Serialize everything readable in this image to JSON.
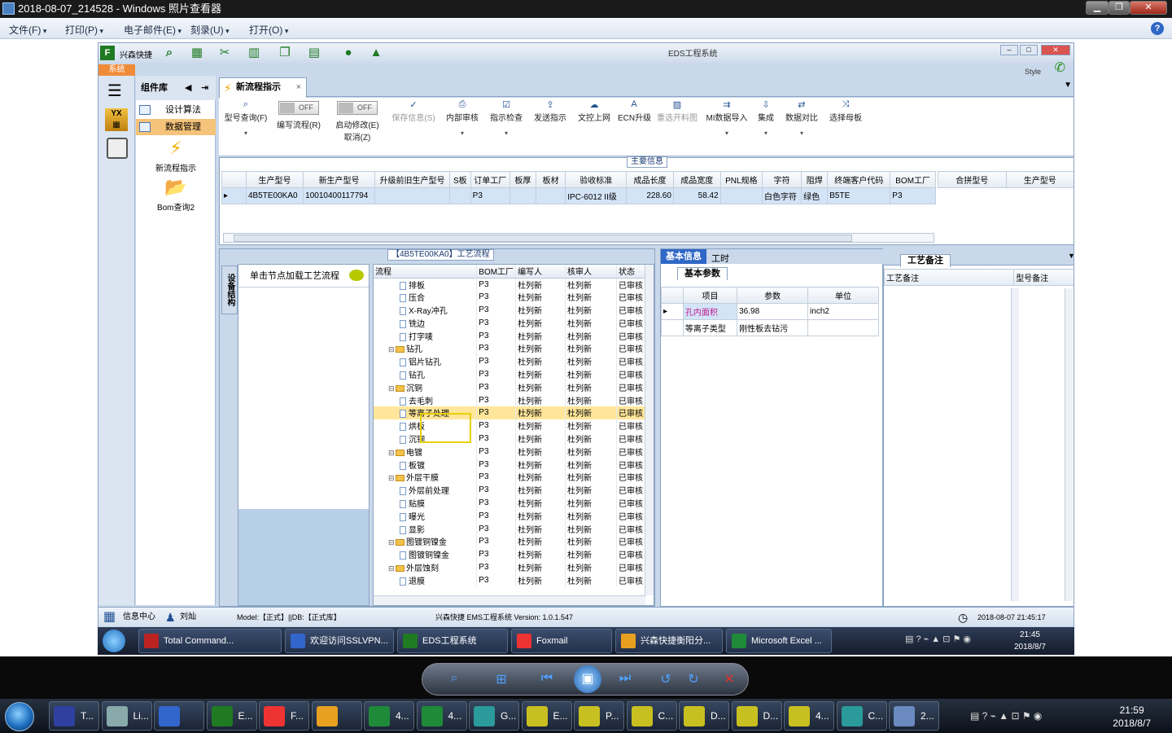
{
  "viewer": {
    "title": "2018-08-07_214528 - Windows 照片查看器",
    "menu": [
      "文件(F)",
      "打印(P)",
      "电子邮件(E)",
      "刻录(U)",
      "打开(O)"
    ]
  },
  "app": {
    "title": "EDS工程系统",
    "company": "兴森快捷",
    "style": "Style",
    "system_tab": "系统",
    "component_lib": "组件库",
    "components": [
      "设计算法",
      "数据管理"
    ],
    "big_items": [
      "新流程指示",
      "Bom查询2"
    ],
    "tab": "新流程指示",
    "toolbar": [
      {
        "label": "型号查询(F)",
        "icon": "magnifier-icon"
      },
      {
        "label": "编写流程(R)",
        "toggle": "OFF"
      },
      {
        "label": "启动修改(E)\n取消(Z)",
        "toggle": "OFF"
      },
      {
        "label": "保存信息(S)",
        "icon": "check-icon",
        "disabled": true
      },
      {
        "label": "内部审核",
        "icon": "printer-icon"
      },
      {
        "label": "指示检查",
        "icon": "checkbox-icon"
      },
      {
        "label": "发送指示",
        "icon": "upload-icon"
      },
      {
        "label": "文控上网",
        "icon": "cloud-icon"
      },
      {
        "label": "ECN升级",
        "icon": "a-icon"
      },
      {
        "label": "重选开料图",
        "icon": "image-icon",
        "disabled": true
      },
      {
        "label": "MI数据导入",
        "icon": "import-icon"
      },
      {
        "label": "集成",
        "icon": "download-icon"
      },
      {
        "label": "数据对比",
        "icon": "compare-icon"
      },
      {
        "label": "选择母板",
        "icon": "shuffle-icon"
      }
    ],
    "main_caption": "主要信息",
    "main_columns": [
      "生产型号",
      "新生产型号",
      "升级前旧生产型号",
      "S板",
      "订单工厂",
      "板厚",
      "板材",
      "验收标准",
      "成品长度",
      "成品宽度",
      "PNL规格",
      "字符",
      "阻焊",
      "终端客户代码",
      "BOM工厂"
    ],
    "main_row": [
      "4B5TE00KA0",
      "10010400117794",
      "",
      "",
      "P3",
      "",
      "",
      "IPC-6012 II级",
      "228.60",
      "58.42",
      "",
      "白色字符",
      "绿色",
      "B5TE",
      "P3"
    ],
    "side_columns": [
      "合拼型号",
      "生产型号"
    ],
    "proc_caption": "【4B5TE00KA0】工艺流程",
    "side_tab": "设备结构",
    "node_hint": "单击节点加载工艺流程",
    "tree_columns": [
      "流程",
      "BOM工厂",
      "编写人",
      "核审人",
      "状态"
    ],
    "tree_rows": [
      {
        "name": "排板",
        "lvl": 2
      },
      {
        "name": "压合",
        "lvl": 2
      },
      {
        "name": "X-Ray冲孔",
        "lvl": 2
      },
      {
        "name": "铣边",
        "lvl": 2
      },
      {
        "name": "打字唛",
        "lvl": 2
      },
      {
        "name": "钻孔",
        "lvl": 1
      },
      {
        "name": "铝片钻孔",
        "lvl": 2
      },
      {
        "name": "钻孔",
        "lvl": 2
      },
      {
        "name": "沉铜",
        "lvl": 1
      },
      {
        "name": "去毛刺",
        "lvl": 2
      },
      {
        "name": "等离子处理",
        "lvl": 2,
        "hl": true
      },
      {
        "name": "烘板",
        "lvl": 2
      },
      {
        "name": "沉铜",
        "lvl": 2
      },
      {
        "name": "电镀",
        "lvl": 1
      },
      {
        "name": "板镀",
        "lvl": 2
      },
      {
        "name": "外层干膜",
        "lvl": 1
      },
      {
        "name": "外层前处理",
        "lvl": 2
      },
      {
        "name": "贴膜",
        "lvl": 2
      },
      {
        "name": "曝光",
        "lvl": 2
      },
      {
        "name": "显影",
        "lvl": 2
      },
      {
        "name": "图镀铜镍金",
        "lvl": 1
      },
      {
        "name": "图镀铜镍金",
        "lvl": 2
      },
      {
        "name": "外层蚀刻",
        "lvl": 1
      },
      {
        "name": "退膜",
        "lvl": 2
      }
    ],
    "tree_defaults": {
      "bom": "P3",
      "writer": "杜列新",
      "checker": "杜列新",
      "status": "已审核"
    },
    "info_tabs": [
      "基本信息",
      "工时"
    ],
    "basic_params": "基本参数",
    "param_columns": [
      "项目",
      "参数",
      "单位"
    ],
    "params": [
      [
        "孔内面积",
        "36.98",
        "inch2"
      ],
      [
        "等离子类型",
        "刚性板去钻污",
        ""
      ]
    ],
    "remark_tab": "工艺备注",
    "remark_columns": [
      "工艺备注",
      "型号备注"
    ],
    "status": {
      "center": "信息中心",
      "user": "刘灿",
      "model": "Model:【正式】||DB:【正式库】",
      "version": "兴森快捷 EMS工程系统 Version: 1.0.1.547",
      "time": "2018-08-07 21:45:17"
    }
  },
  "inner_taskbar": {
    "items": [
      "Total Command...",
      "欢迎访问SSLVPN...",
      "EDS工程系统",
      "Foxmail",
      "兴森快捷衡阳分...",
      "Microsoft Excel ..."
    ],
    "time": "21:45",
    "date": "2018/8/7"
  },
  "outer_taskbar": {
    "items": [
      "T...",
      "Li...",
      "",
      "E...",
      "F...",
      "",
      "4...",
      "4...",
      "G...",
      "E...",
      "P...",
      "C...",
      "D...",
      "D...",
      "4...",
      "C...",
      "2..."
    ],
    "time": "21:59",
    "date": "2018/8/7"
  },
  "colors": {
    "accent": "#2f67c7",
    "highlight": "#ffe69a",
    "orange": "#f08b3a"
  }
}
